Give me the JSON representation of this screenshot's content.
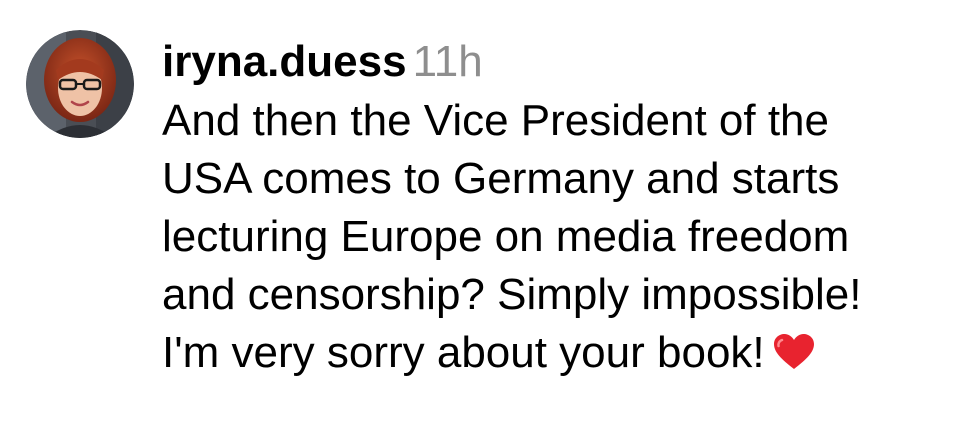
{
  "comment": {
    "username": "iryna.duess",
    "timestamp": "11h",
    "body_lines": [
      "And then the Vice President of the",
      "USA comes to Germany and starts",
      "lecturing Europe on media freedom",
      "and censorship? Simply impossible!",
      "I'm very sorry about your book!"
    ],
    "emoji": "red-heart-icon"
  },
  "colors": {
    "timestamp": "#8e8e8e",
    "heart": "#e8232f"
  }
}
